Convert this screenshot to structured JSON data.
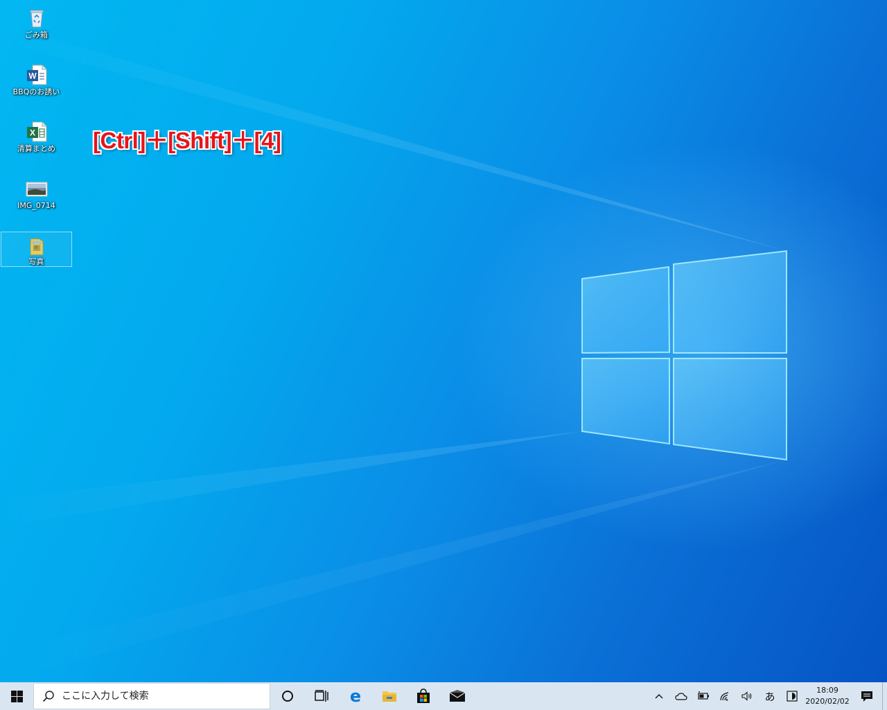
{
  "desktop": {
    "icons": [
      {
        "label": "ごみ箱",
        "icon": "recycle-bin-icon"
      },
      {
        "label": "BBQのお誘い",
        "icon": "word-document-icon"
      },
      {
        "label": "清算まとめ",
        "icon": "excel-workbook-icon"
      },
      {
        "label": "IMG_0714",
        "icon": "image-file-icon"
      },
      {
        "label": "写真",
        "icon": "folder-icon"
      }
    ],
    "annotation": "[Ctrl]＋[Shift]＋[4]"
  },
  "taskbar": {
    "search_placeholder": "ここに入力して検索",
    "pinned": [
      "cortana-icon",
      "task-view-icon",
      "edge-icon",
      "file-explorer-icon",
      "store-icon",
      "mail-icon"
    ],
    "tray": {
      "ime": "あ",
      "time": "18:09",
      "date": "2020/02/02"
    }
  },
  "colors": {
    "annotation": "#e8141b",
    "taskbar": "#d9e6f2",
    "desktop_accent": "#03a9ee"
  }
}
